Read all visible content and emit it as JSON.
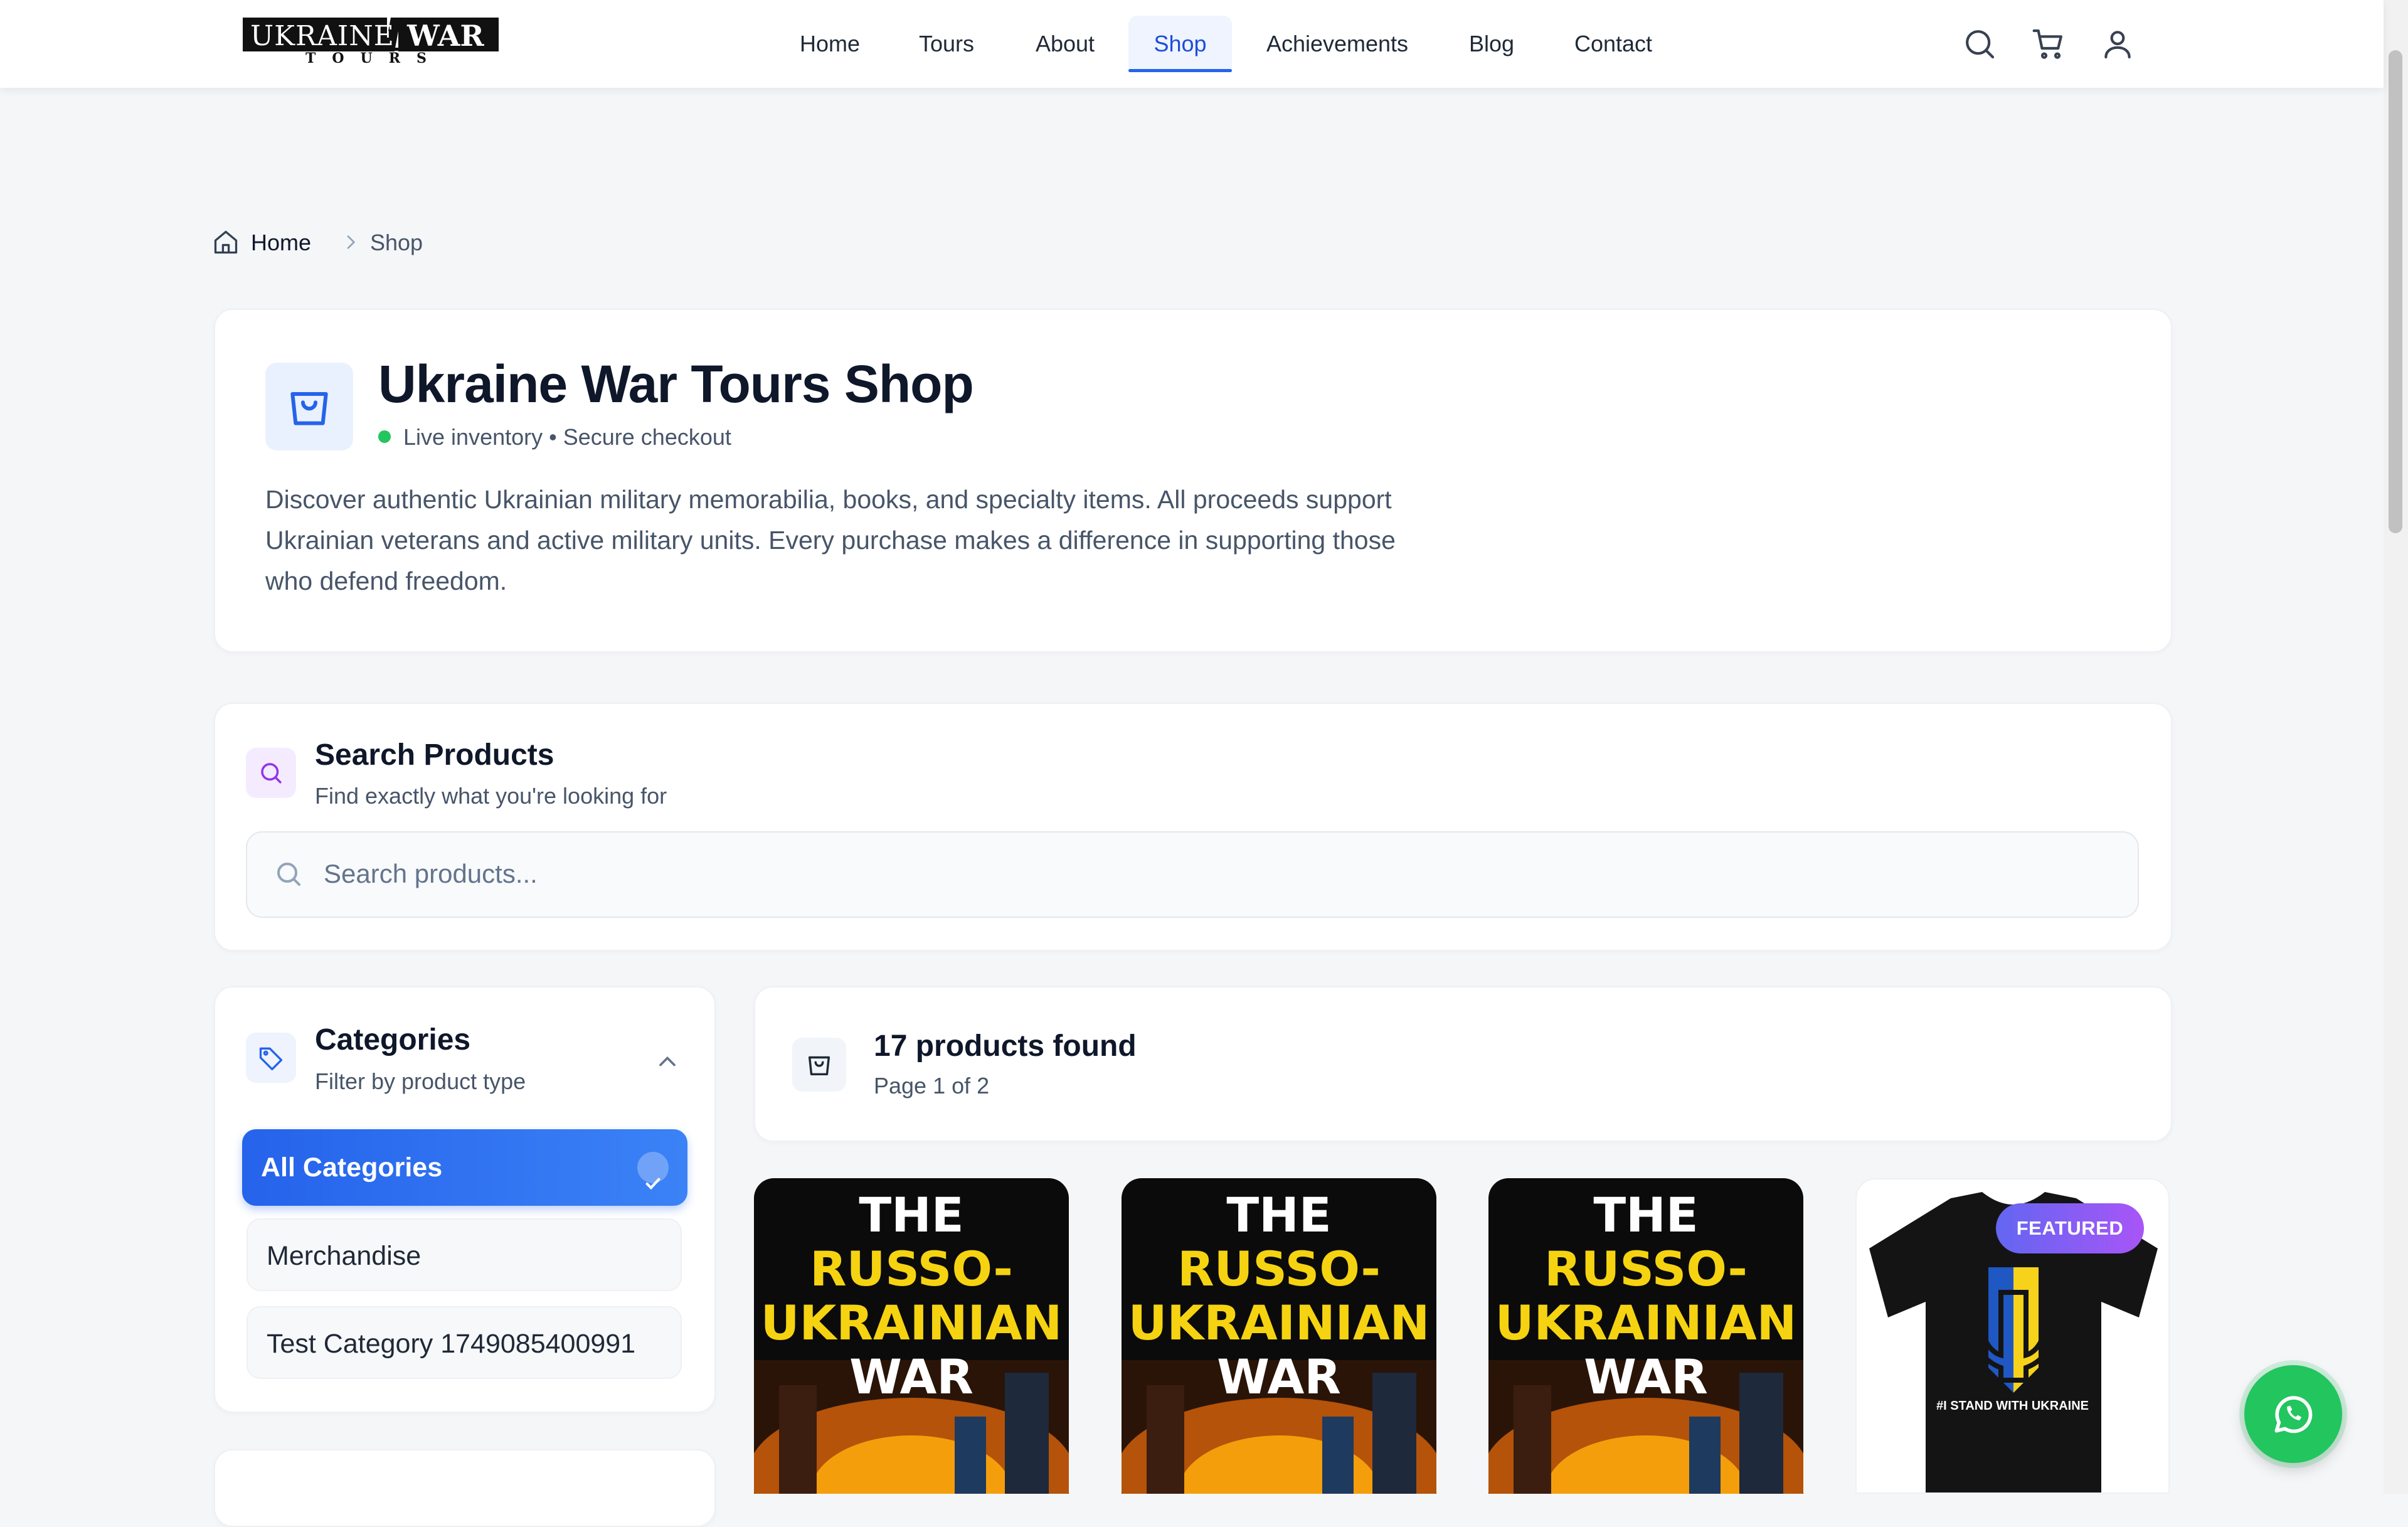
{
  "header": {
    "logo": {
      "line1": "UKRAINE",
      "line1b": "WAR",
      "line2": "TOURS",
      "alt": "Ukraine War Tours logo"
    },
    "nav": [
      {
        "label": "Home",
        "active": false
      },
      {
        "label": "Tours",
        "active": false
      },
      {
        "label": "About",
        "active": false
      },
      {
        "label": "Shop",
        "active": true
      },
      {
        "label": "Achievements",
        "active": false
      },
      {
        "label": "Blog",
        "active": false
      },
      {
        "label": "Contact",
        "active": false
      }
    ],
    "icons": [
      "search-icon",
      "cart-icon",
      "user-icon"
    ]
  },
  "breadcrumb": {
    "home": "Home",
    "current": "Shop"
  },
  "hero": {
    "title": "Ukraine War Tours Shop",
    "status": "Live inventory • Secure checkout",
    "status_color": "#22c55e",
    "description_lines": [
      "Discover authentic Ukrainian military memorabilia, books, and specialty items. All proceeds support",
      "Ukrainian veterans and active military units. Every purchase makes a difference in supporting those",
      "who defend freedom."
    ]
  },
  "search": {
    "title": "Search Products",
    "subtitle": "Find exactly what you're looking for",
    "placeholder": "Search products...",
    "value": ""
  },
  "categories": {
    "title": "Categories",
    "subtitle": "Filter by product type",
    "items": [
      {
        "label": "All Categories",
        "active": true
      },
      {
        "label": "Merchandise",
        "active": false
      },
      {
        "label": "Test Category 1749085400991",
        "active": false
      }
    ]
  },
  "results": {
    "count_text": "17 products found",
    "page_text": "Page 1 of 2"
  },
  "products": [
    {
      "kind": "book",
      "lines": [
        "THE",
        "RUSSO-",
        "UKRAINIAN",
        "WAR"
      ]
    },
    {
      "kind": "book",
      "lines": [
        "THE",
        "RUSSO-",
        "UKRAINIAN",
        "WAR"
      ]
    },
    {
      "kind": "book",
      "lines": [
        "THE",
        "RUSSO-",
        "UKRAINIAN",
        "WAR"
      ]
    },
    {
      "kind": "tshirt",
      "badge": "FEATURED",
      "shirt_text": "#I STAND WITH UKRAINE"
    }
  ],
  "colors": {
    "accent": "#2563eb",
    "book_yellow": "#f5d311",
    "ua_blue": "#1f57c3",
    "ua_yellow": "#f7d21b",
    "whatsapp": "#22c55e"
  }
}
